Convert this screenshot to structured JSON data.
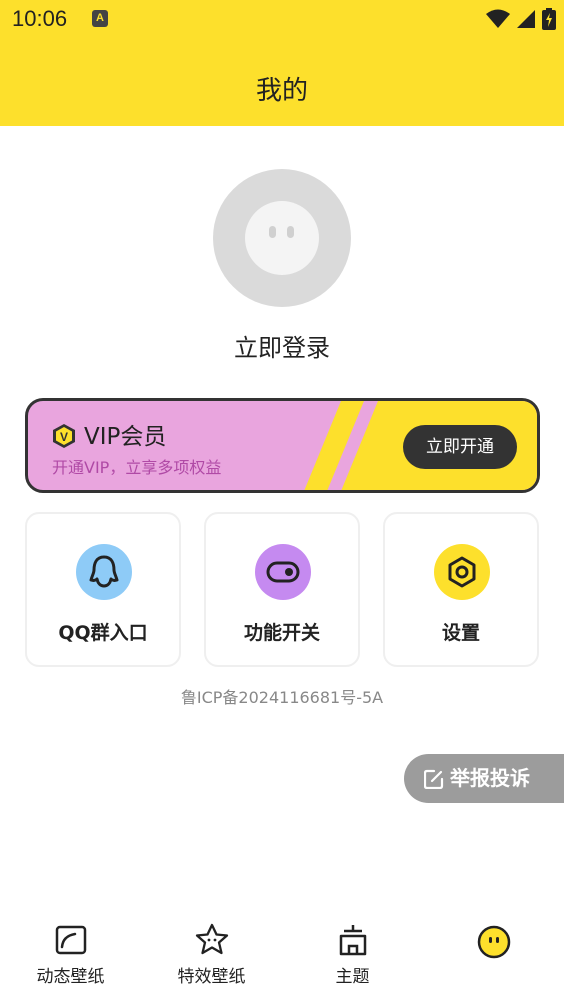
{
  "status_bar": {
    "time": "10:06",
    "notification_badge": "A"
  },
  "header": {
    "title": "我的"
  },
  "profile": {
    "login_text": "立即登录"
  },
  "vip": {
    "badge": "V",
    "title": "VIP会员",
    "subtitle": "开通VIP，立享多项权益",
    "button": "立即开通"
  },
  "tiles": [
    {
      "label": "QQ群入口",
      "icon": "qq-penguin-icon",
      "color": "#8ecbf7"
    },
    {
      "label": "功能开关",
      "icon": "toggle-icon",
      "color": "#c58af0"
    },
    {
      "label": "设置",
      "icon": "gear-hexagon-icon",
      "color": "#fde02c"
    }
  ],
  "icp": "鲁ICP备2024116681号-5A",
  "report_button": {
    "label": "举报投诉",
    "icon": "edit-icon"
  },
  "tabs": [
    {
      "label": "动态壁纸",
      "icon": "wallpaper-icon"
    },
    {
      "label": "特效壁纸",
      "icon": "star-face-icon"
    },
    {
      "label": "主题",
      "icon": "theme-house-icon"
    },
    {
      "label": "",
      "icon": "smiley-face-icon",
      "active": true
    }
  ],
  "colors": {
    "brand_yellow": "#fde02c",
    "vip_pink": "#e9a5de",
    "dark": "#333333"
  }
}
